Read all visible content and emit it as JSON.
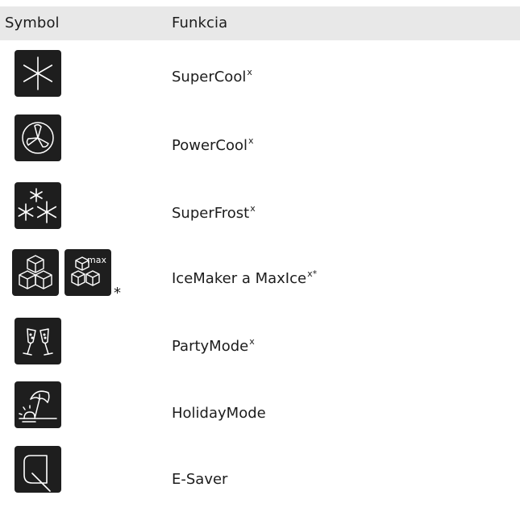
{
  "table": {
    "headers": {
      "symbol": "Symbol",
      "function": "Funkcia"
    },
    "rows": [
      {
        "icon": "snowflake-icon",
        "label": "SuperCool",
        "sup": "x"
      },
      {
        "icon": "fan-icon",
        "label": "PowerCool",
        "sup": "x"
      },
      {
        "icon": "snowflakes-icon",
        "label": "SuperFrost",
        "sup": "x"
      },
      {
        "icon": "ice-cubes-icon",
        "icon2": "ice-cubes-max-icon",
        "icon2_text": "max",
        "icon_note": "*",
        "label": "IceMaker a MaxIce",
        "sup": "x*"
      },
      {
        "icon": "champagne-glasses-icon",
        "label": "PartyMode",
        "sup": "x"
      },
      {
        "icon": "beach-umbrella-icon",
        "label": "HolidayMode",
        "sup": ""
      },
      {
        "icon": "leaf-icon",
        "label": "E-Saver",
        "sup": ""
      }
    ]
  }
}
